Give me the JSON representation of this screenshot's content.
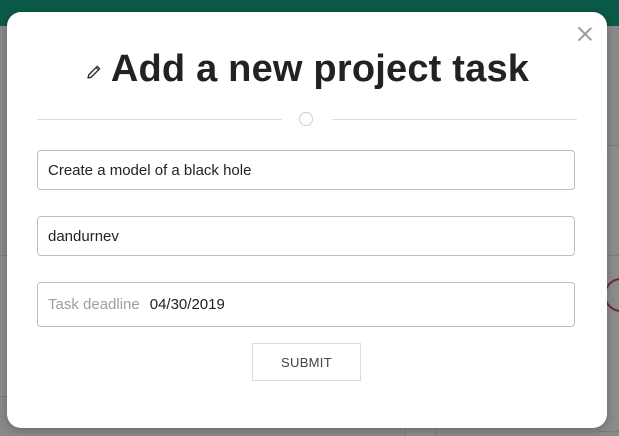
{
  "modal": {
    "title": "Add a new project task",
    "icon": "pencil-icon",
    "close_icon": "close-icon"
  },
  "form": {
    "task_name": "Create a model of a black hole",
    "assignee": "dandurnev",
    "deadline_label": "Task deadline",
    "deadline_value": "04/30/2019",
    "submit_label": "SUBMIT"
  },
  "colors": {
    "topbar": "#0b5a47",
    "backdrop": "#8a8a8a",
    "title_text": "#222222"
  }
}
